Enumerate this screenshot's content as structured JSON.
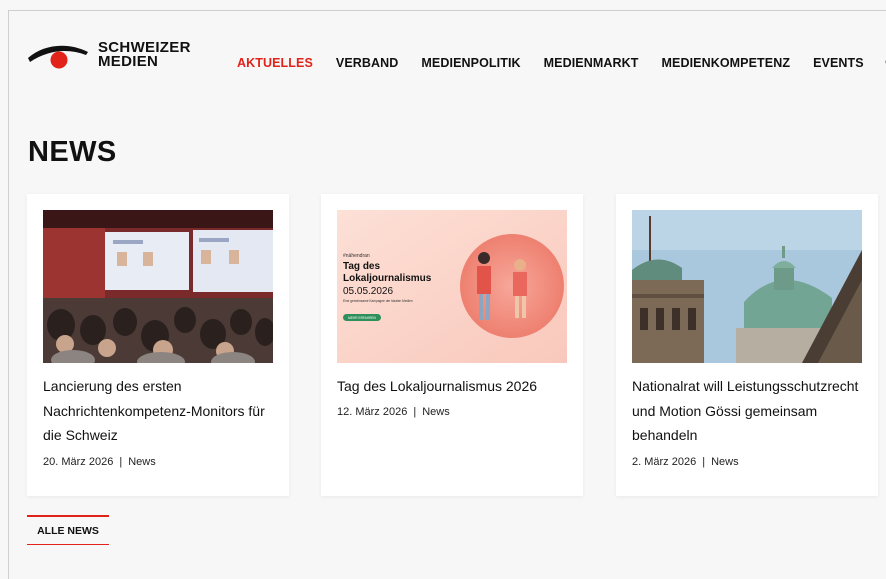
{
  "brand": {
    "line1": "SCHWEIZER",
    "line2": "MEDIEN",
    "logo_colors": [
      "#111111",
      "#e2231a"
    ]
  },
  "nav": {
    "items": [
      {
        "label": "AKTUELLES",
        "active": true
      },
      {
        "label": "VERBAND"
      },
      {
        "label": "MEDIENPOLITIK"
      },
      {
        "label": "MEDIENMARKT"
      },
      {
        "label": "MEDIENKOMPETENZ"
      },
      {
        "label": "EVENTS"
      }
    ],
    "search_icon": "search-icon"
  },
  "page": {
    "title": "NEWS"
  },
  "news": [
    {
      "title": "Lancierung des ersten Nachrichtenkompetenz-Monitors für die Schweiz",
      "date": "20. März 2026",
      "category": "News",
      "image": "conference-audience-photo"
    },
    {
      "title": "Tag des Lokaljournalismus 2026",
      "date": "12. März 2026",
      "category": "News",
      "image": "event-banner",
      "banner": {
        "hashtag": "#nähendran",
        "headline1": "Tag des",
        "headline2": "Lokaljournalismus",
        "date": "05.05.2026",
        "sub": "Eine gemeinsame Kampagne der lokalen Medien",
        "button": "MEHR ERFAHREN"
      }
    },
    {
      "title": "Nationalrat will Leistungsschutzrecht und Motion Gössi gemeinsam behandeln",
      "date": "2. März 2026",
      "category": "News",
      "image": "bundeshaus-dome-photo"
    }
  ],
  "all_news": {
    "label": "ALLE NEWS"
  },
  "colors": {
    "accent": "#e2231a",
    "background": "#f7f7f7",
    "card": "#ffffff"
  }
}
